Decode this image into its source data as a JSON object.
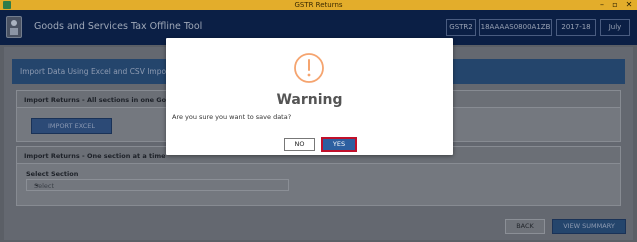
{
  "window": {
    "title": "GSTR Returns",
    "controls": {
      "minimize": "–",
      "maximize": "▫",
      "close": "✕"
    }
  },
  "header": {
    "app_title": "Goods and Services Tax Offline Tool",
    "return_type": "GSTR2",
    "gstin": "18AAAAS0800A1ZB",
    "fin_year": "2017-18",
    "month": "July"
  },
  "panel": {
    "title": "Import Data Using Excel and CSV Import"
  },
  "import_all": {
    "heading": "Import Returns - All sections in one Go",
    "button_label": "IMPORT EXCEL"
  },
  "import_one": {
    "heading": "Import Returns - One section at a time",
    "select_label": "Select Section",
    "select_value": "Select"
  },
  "footer": {
    "back_label": "BACK",
    "summary_label": "VIEW SUMMARY"
  },
  "dialog": {
    "icon": "warning-exclamation-icon",
    "title": "Warning",
    "message": "Are you sure you want to save data?",
    "no_label": "NO",
    "yes_label": "YES",
    "accent_color": "#f5a46f"
  }
}
